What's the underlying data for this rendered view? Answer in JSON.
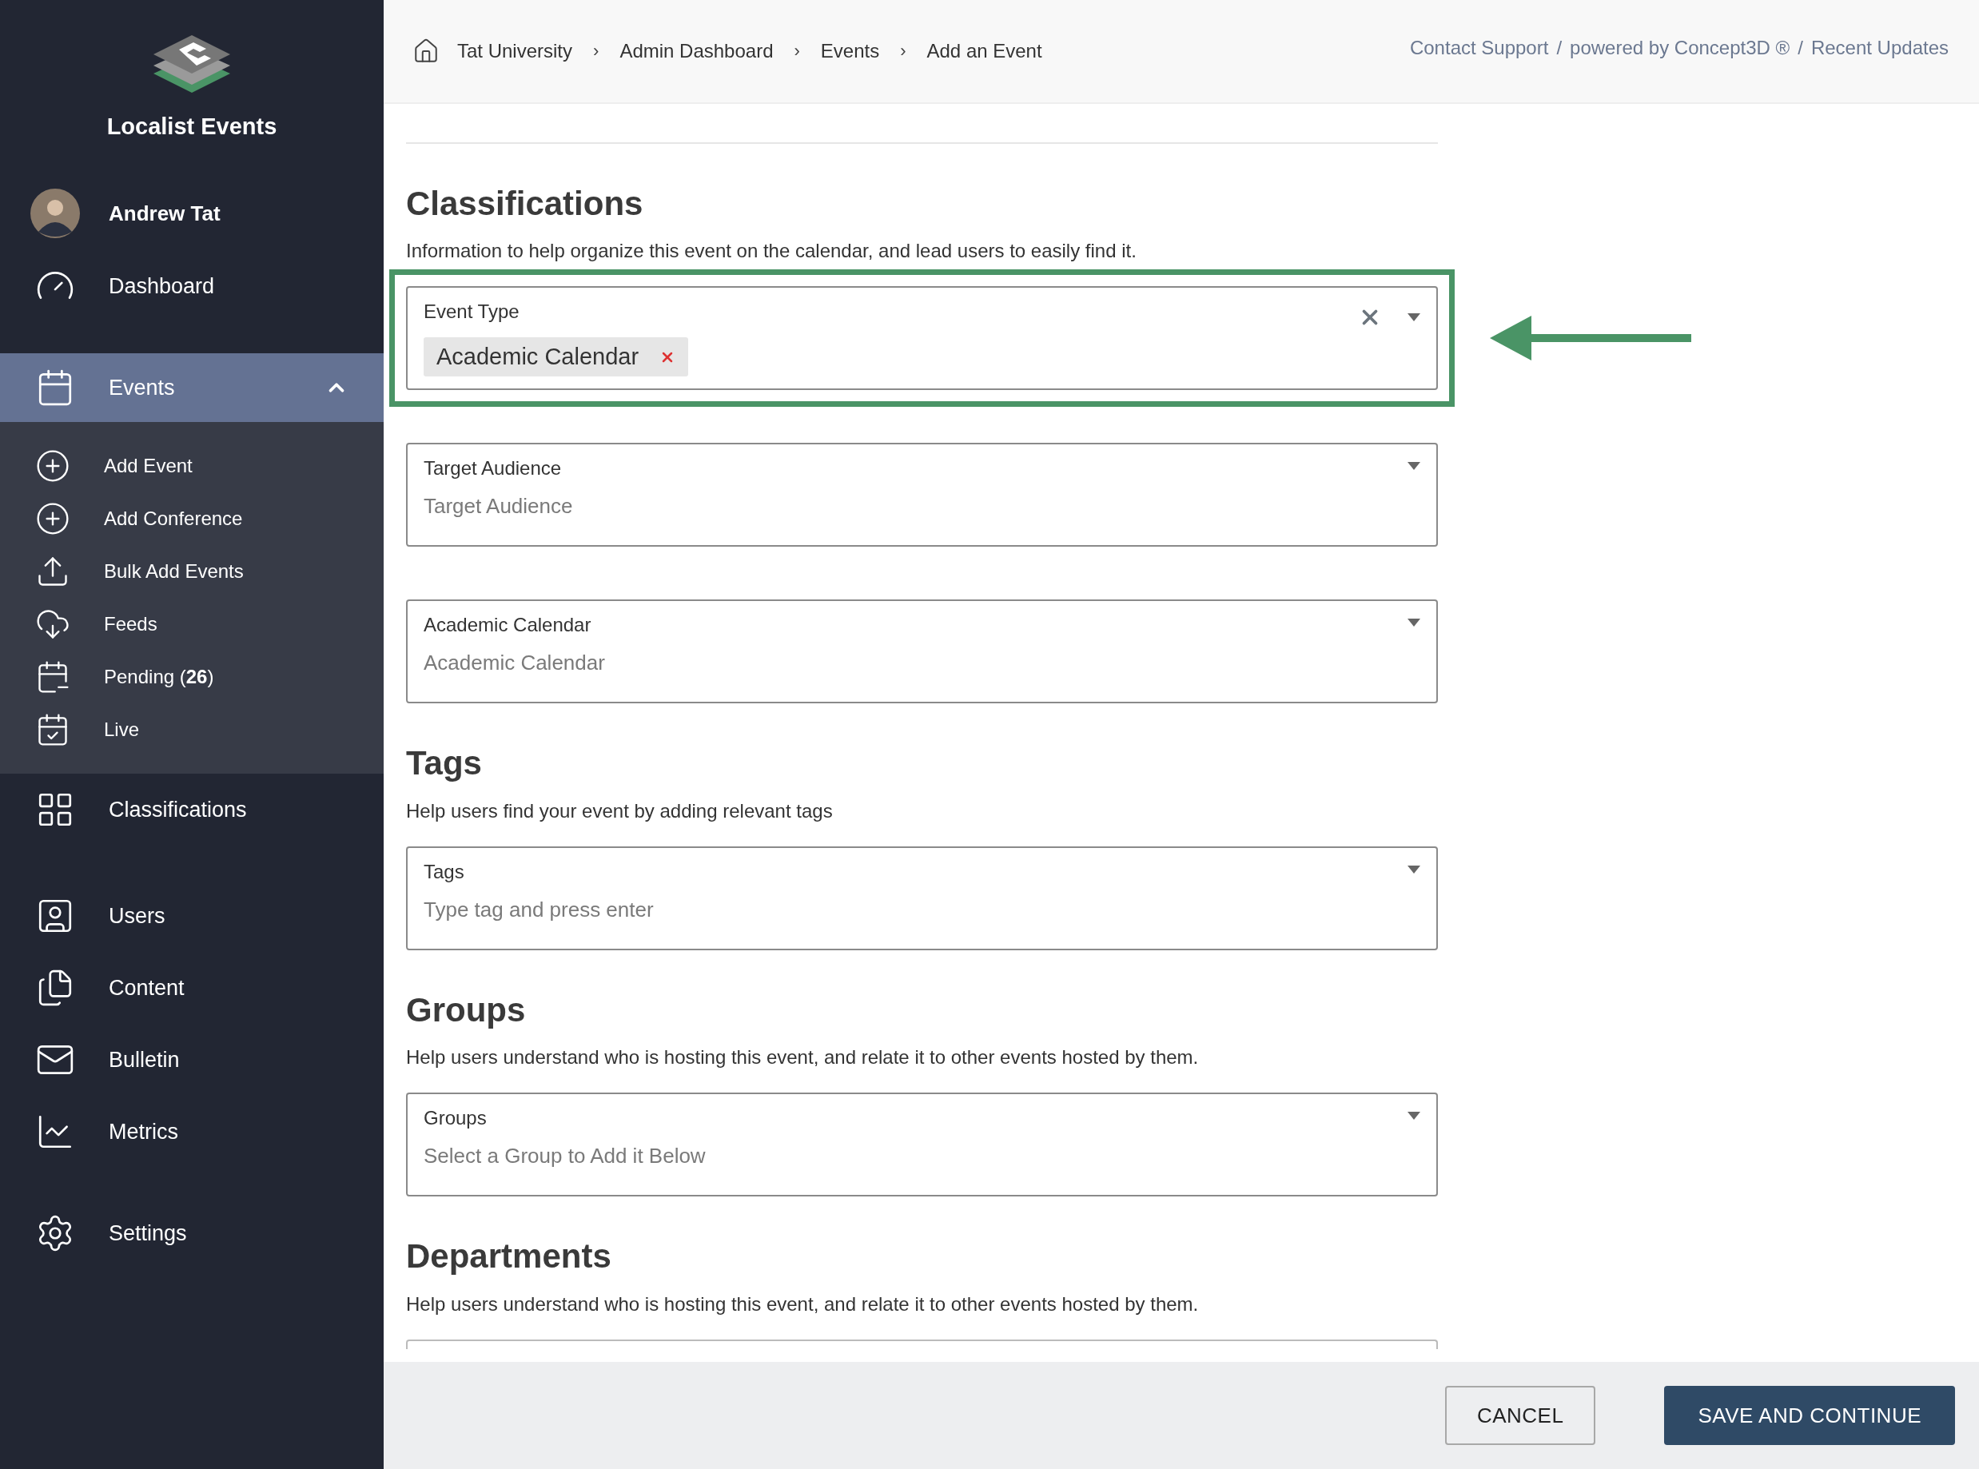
{
  "sidebar": {
    "brand": "Localist Events",
    "user": {
      "name": "Andrew Tat"
    },
    "items": [
      {
        "label": "Dashboard",
        "selected": false
      },
      {
        "label": "Events",
        "selected": true,
        "expanded": true,
        "children": [
          {
            "label": "Add Event"
          },
          {
            "label": "Add Conference"
          },
          {
            "label": "Bulk Add Events"
          },
          {
            "label": "Feeds"
          },
          {
            "label": "Pending (**26**)"
          },
          {
            "label": "Live"
          }
        ]
      },
      {
        "label": "Classifications",
        "selected": false
      },
      {
        "label": "Users",
        "selected": false
      },
      {
        "label": "Content",
        "selected": false
      },
      {
        "label": "Bulletin",
        "selected": false
      },
      {
        "label": "Metrics",
        "selected": false
      },
      {
        "label": "Settings",
        "selected": false
      }
    ]
  },
  "breadcrumbs": [
    {
      "label": "Tat University",
      "separator": "›"
    },
    {
      "label": "Admin Dashboard",
      "separator": "›"
    },
    {
      "label": "Events",
      "separator": "›"
    },
    {
      "label": "Add an Event"
    }
  ],
  "header_links": [
    {
      "label": "Contact Support",
      "separator": "/"
    },
    {
      "label": "powered by Concept3D ®",
      "separator": "/"
    },
    {
      "label": "Recent Updates"
    }
  ],
  "sections": [
    {
      "title": "Classifications",
      "description": "Information to help organize this event on the calendar, and lead users to easily find it.",
      "fields": [
        {
          "kind": "select",
          "label": "Event Type",
          "tags": [
            "Academic Calendar"
          ],
          "clearable": true,
          "highlighted": true
        },
        {
          "kind": "select",
          "label": "Target Audience",
          "placeholder": "Target Audience"
        },
        {
          "kind": "select",
          "label": "Academic Calendar",
          "placeholder": "Academic Calendar"
        }
      ]
    },
    {
      "title": "Tags",
      "description": "Help users find your event by adding relevant tags",
      "fields": [
        {
          "kind": "select",
          "label": "Tags",
          "placeholder": "Type tag and press enter"
        }
      ]
    },
    {
      "title": "Groups",
      "description": "Help users understand who is hosting this event, and relate it to other events hosted by them.",
      "fields": [
        {
          "kind": "select",
          "label": "Groups",
          "placeholder": "Select a Group to Add it Below"
        }
      ]
    },
    {
      "title": "Departments",
      "description": "Help users understand who is hosting this event, and relate it to other events hosted by them.",
      "fields": [
        {
          "kind": "covered"
        }
      ]
    }
  ],
  "footer": {
    "buttons": [
      {
        "label": "CANCEL",
        "kind": "secondary"
      },
      {
        "label": "SAVE AND CONTINUE",
        "kind": "primary"
      }
    ]
  }
}
